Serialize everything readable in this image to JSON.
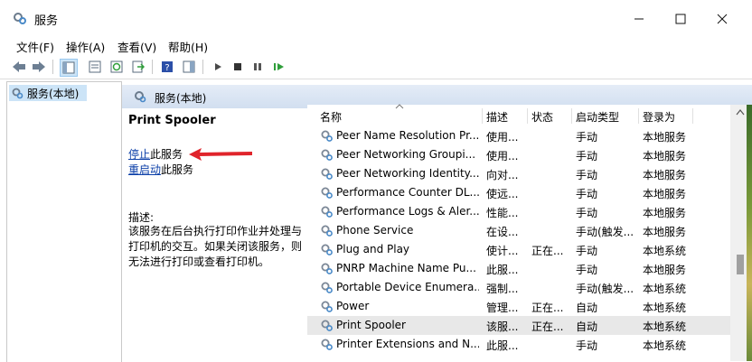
{
  "window": {
    "title": "服务"
  },
  "menu": [
    "文件(F)",
    "操作(A)",
    "查看(V)",
    "帮助(H)"
  ],
  "tree": {
    "root_label": "服务(本地)"
  },
  "pane": {
    "header_label": "服务(本地)"
  },
  "details": {
    "service_title": "Print Spooler",
    "stop_link": "停止",
    "stop_suffix": "此服务",
    "restart_link": "重启动",
    "restart_suffix": "此服务",
    "desc_label": "描述:",
    "desc_text": "该服务在后台执行打印作业并处理与打印机的交互。如果关闭该服务，则无法进行打印或查看打印机。"
  },
  "columns": [
    "名称",
    "描述",
    "状态",
    "启动类型",
    "登录为"
  ],
  "rows": [
    {
      "name": "Peer Name Resolution Pr...",
      "desc": "使用...",
      "status": "",
      "startup": "手动",
      "logon": "本地服务"
    },
    {
      "name": "Peer Networking Groupi...",
      "desc": "使用...",
      "status": "",
      "startup": "手动",
      "logon": "本地服务"
    },
    {
      "name": "Peer Networking Identity...",
      "desc": "向对...",
      "status": "",
      "startup": "手动",
      "logon": "本地服务"
    },
    {
      "name": "Performance Counter DL...",
      "desc": "使远...",
      "status": "",
      "startup": "手动",
      "logon": "本地服务"
    },
    {
      "name": "Performance Logs & Aler...",
      "desc": "性能...",
      "status": "",
      "startup": "手动",
      "logon": "本地服务"
    },
    {
      "name": "Phone Service",
      "desc": "在设...",
      "status": "",
      "startup": "手动(触发...",
      "logon": "本地服务"
    },
    {
      "name": "Plug and Play",
      "desc": "使计...",
      "status": "正在...",
      "startup": "手动",
      "logon": "本地系统"
    },
    {
      "name": "PNRP Machine Name Pu...",
      "desc": "此服...",
      "status": "",
      "startup": "手动",
      "logon": "本地服务"
    },
    {
      "name": "Portable Device Enumera...",
      "desc": "强制...",
      "status": "",
      "startup": "手动(触发...",
      "logon": "本地系统"
    },
    {
      "name": "Power",
      "desc": "管理...",
      "status": "正在...",
      "startup": "自动",
      "logon": "本地系统"
    },
    {
      "name": "Print Spooler",
      "desc": "该服...",
      "status": "正在...",
      "startup": "自动",
      "logon": "本地系统"
    },
    {
      "name": "Printer Extensions and N...",
      "desc": "此服...",
      "status": "",
      "startup": "手动",
      "logon": "本地系统"
    }
  ],
  "selected_row": 10,
  "colors": {
    "link": "#0b3fa8",
    "arrow": "#e0242b",
    "header_bg": "#d8e3f2",
    "tree_select": "#cce4f7"
  }
}
